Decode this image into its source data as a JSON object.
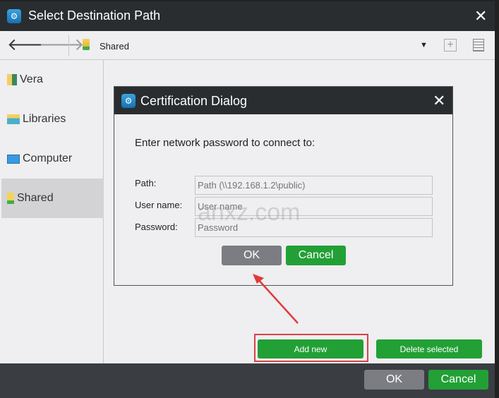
{
  "window": {
    "title": "Select Destination Path",
    "close_icon": "close-icon"
  },
  "toolbar": {
    "location": "Shared"
  },
  "sidebar": {
    "items": [
      {
        "label": "Vera",
        "icon": "user-folder-icon"
      },
      {
        "label": "Libraries",
        "icon": "libraries-icon"
      },
      {
        "label": "Computer",
        "icon": "computer-icon"
      },
      {
        "label": "Shared",
        "icon": "shared-folder-icon",
        "selected": true
      }
    ]
  },
  "dialog": {
    "title": "Certification Dialog",
    "prompt": "Enter network password to connect to:",
    "path_label": "Path:",
    "path_placeholder": "Path (\\\\192.168.1.2\\public)",
    "user_label": "User name:",
    "user_placeholder": "User name",
    "password_label": "Password:",
    "password_placeholder": "Password",
    "ok": "OK",
    "cancel": "Cancel"
  },
  "actions": {
    "add_new": "Add new",
    "delete_selected": "Delete selected"
  },
  "footer": {
    "ok": "OK",
    "cancel": "Cancel"
  },
  "watermark": "anxz.com",
  "colors": {
    "green": "#22a036",
    "gray": "#7b7d82",
    "titlebar": "#2a2d30",
    "highlight": "#d9414a"
  }
}
